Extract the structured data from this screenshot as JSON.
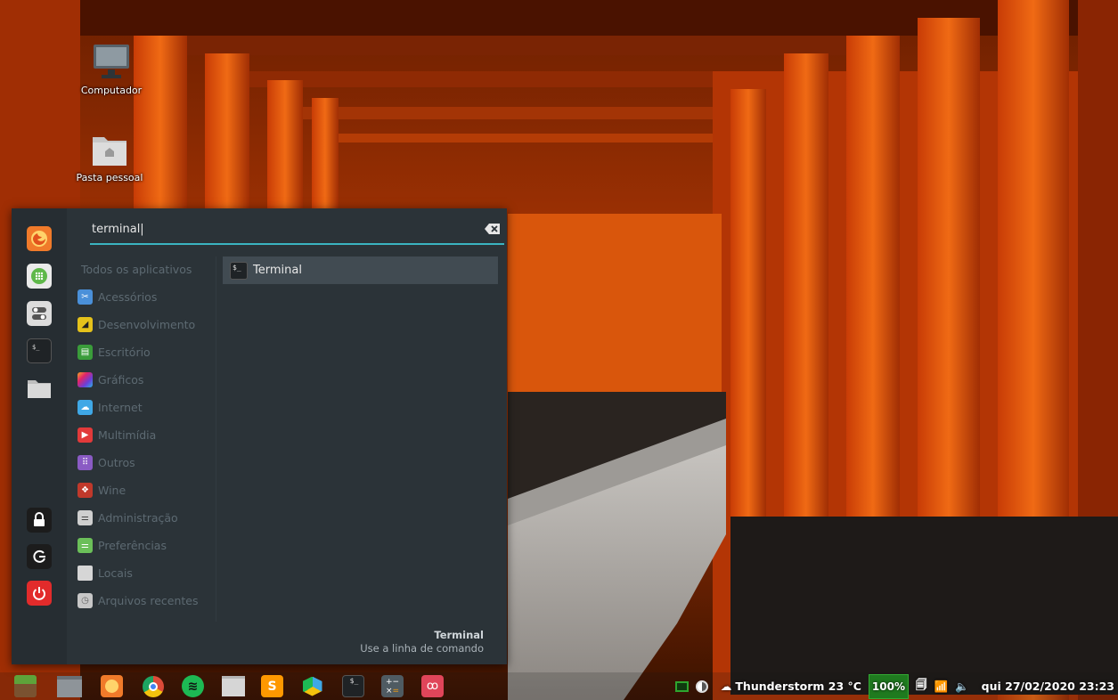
{
  "desktop": {
    "icons": [
      {
        "label": "Computador",
        "icon": "monitor-icon"
      },
      {
        "label": "Pasta pessoal",
        "icon": "home-folder-icon"
      }
    ]
  },
  "menu": {
    "search": {
      "value": "terminal|",
      "placeholder": ""
    },
    "favorites": [
      {
        "name": "Firefox",
        "icon": "firefox-icon",
        "color": "#f07a2a"
      },
      {
        "name": "Apps",
        "icon": "apps-icon",
        "color": "#5fb84a"
      },
      {
        "name": "Settings",
        "icon": "toggle-icon",
        "color": "#d9d9d9"
      },
      {
        "name": "Terminal",
        "icon": "terminal-icon",
        "color": "#1f2326"
      },
      {
        "name": "Files",
        "icon": "folder-icon",
        "color": "#d6d6d6"
      }
    ],
    "session": [
      {
        "name": "Lock",
        "icon": "lock-icon",
        "color": "#1c1c1c"
      },
      {
        "name": "Logout",
        "icon": "logout-icon",
        "color": "#1c1c1c"
      },
      {
        "name": "Shutdown",
        "icon": "power-icon",
        "color": "#e22b2b"
      }
    ],
    "categories": [
      {
        "label": "Todos os aplicativos",
        "icon": ""
      },
      {
        "label": "Acessórios",
        "icon": "accessories-icon",
        "color": "#4a90d9"
      },
      {
        "label": "Desenvolvimento",
        "icon": "development-icon",
        "color": "#e5c21b"
      },
      {
        "label": "Escritório",
        "icon": "office-icon",
        "color": "#3a9c3a"
      },
      {
        "label": "Gráficos",
        "icon": "graphics-icon",
        "color": "#b24ad9"
      },
      {
        "label": "Internet",
        "icon": "internet-icon",
        "color": "#3fa8e6"
      },
      {
        "label": "Multimídia",
        "icon": "multimedia-icon",
        "color": "#e23a3a"
      },
      {
        "label": "Outros",
        "icon": "others-icon",
        "color": "#8a5bc4"
      },
      {
        "label": "Wine",
        "icon": "wine-icon",
        "color": "#c0392b"
      },
      {
        "label": "Administração",
        "icon": "admin-icon",
        "color": "#cfcfcf"
      },
      {
        "label": "Preferências",
        "icon": "preferences-icon",
        "color": "#6bbf59"
      },
      {
        "label": "Locais",
        "icon": "places-icon",
        "color": "#d6d6d6"
      },
      {
        "label": "Arquivos recentes",
        "icon": "recent-icon",
        "color": "#c7c7c7"
      }
    ],
    "results": [
      {
        "label": "Terminal",
        "icon": "terminal-icon"
      }
    ],
    "description": {
      "title": "Terminal",
      "text": "Use a linha de comando"
    }
  },
  "taskbar": {
    "apps": [
      {
        "name": "Minecraft",
        "icon": "minecraft-icon",
        "color": "#5a8f2e"
      },
      {
        "name": "Window",
        "icon": "window-icon",
        "color": "#8e9499"
      },
      {
        "name": "Firefox",
        "icon": "firefox-icon",
        "color": "#f07a2a"
      },
      {
        "name": "Chrome",
        "icon": "chrome-icon",
        "color": "#dd4b39"
      },
      {
        "name": "Spotify",
        "icon": "spotify-icon",
        "color": "#1db954"
      },
      {
        "name": "Files",
        "icon": "folder-icon",
        "color": "#d6d6d6"
      },
      {
        "name": "Sublime",
        "icon": "sublime-icon",
        "color": "#ff9800"
      },
      {
        "name": "Package",
        "icon": "package-icon",
        "color": "#3fa8e6"
      },
      {
        "name": "Terminal",
        "icon": "terminal-icon",
        "color": "#1f2326"
      },
      {
        "name": "Calculator",
        "icon": "calculator-icon",
        "color": "#4f5b62"
      },
      {
        "name": "Reader",
        "icon": "glasses-icon",
        "color": "#e0455a"
      }
    ],
    "tray": {
      "weather": "Thunderstorm 23 °C",
      "battery": "100%",
      "clock": "qui 27/02/2020 23:23"
    }
  }
}
